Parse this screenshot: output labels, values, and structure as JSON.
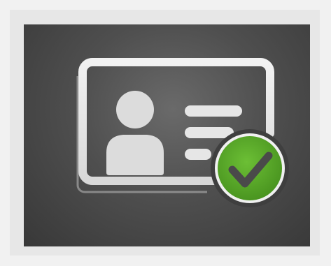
{
  "icon": {
    "name": "id-card-verified-icon",
    "card_icon": "id-card-icon",
    "avatar_icon": "user-silhouette-icon",
    "badge_icon": "checkmark-icon",
    "colors": {
      "background_outer": "#f1f1f1",
      "background_panel": "#e7e7e7",
      "tile_dark": "#383838",
      "tile_light": "#6a6a6a",
      "card_outline": "#e9e9e9",
      "avatar": "#dcdcdc",
      "badge_fill": "#5aa526",
      "badge_ring": "#f0f0f0",
      "check_mark": "#4a4a4a"
    }
  }
}
